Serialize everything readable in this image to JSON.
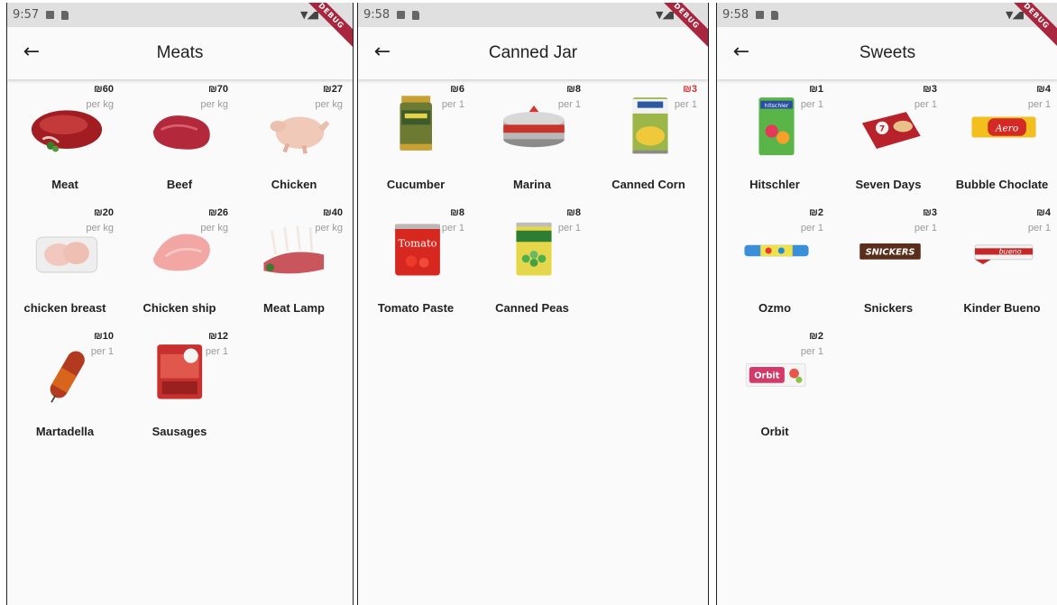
{
  "screens": [
    {
      "time": "9:57",
      "title": "Meats",
      "debug": "DEBUG",
      "items": [
        {
          "name": "Meat",
          "price": "₪60",
          "unit": "per kg",
          "icon": "meat-icon"
        },
        {
          "name": "Beef",
          "price": "₪70",
          "unit": "per kg",
          "icon": "beef-icon"
        },
        {
          "name": "Chicken",
          "price": "₪27",
          "unit": "per kg",
          "icon": "chicken-icon"
        },
        {
          "name": "chicken breast",
          "price": "₪20",
          "unit": "per kg",
          "icon": "chicken-breast-icon"
        },
        {
          "name": "Chicken ship",
          "price": "₪26",
          "unit": "per kg",
          "icon": "chicken-ship-icon"
        },
        {
          "name": "Meat Lamp",
          "price": "₪40",
          "unit": "per kg",
          "icon": "lamb-rack-icon"
        },
        {
          "name": "Martadella",
          "price": "₪10",
          "unit": "per 1",
          "icon": "mortadella-icon"
        },
        {
          "name": "Sausages",
          "price": "₪12",
          "unit": "per 1",
          "icon": "sausages-icon"
        }
      ]
    },
    {
      "time": "9:58",
      "title": "Canned Jar",
      "debug": "DEBUG",
      "items": [
        {
          "name": "Cucumber",
          "price": "₪6",
          "unit": "per 1",
          "icon": "cucumber-jar-icon"
        },
        {
          "name": "Marina",
          "price": "₪8",
          "unit": "per 1",
          "icon": "tuna-can-icon"
        },
        {
          "name": "Canned Corn",
          "price": "₪3",
          "unit": "per 1",
          "icon": "corn-can-icon",
          "price_color": "#d32f2f"
        },
        {
          "name": "Tomato Paste",
          "price": "₪8",
          "unit": "per 1",
          "icon": "tomato-paste-icon"
        },
        {
          "name": "Canned Peas",
          "price": "₪8",
          "unit": "per 1",
          "icon": "peas-can-icon"
        }
      ]
    },
    {
      "time": "9:58",
      "title": "Sweets",
      "debug": "DEBUG",
      "items": [
        {
          "name": "Hitschler",
          "price": "₪1",
          "unit": "per 1",
          "icon": "hitschler-icon"
        },
        {
          "name": "Seven Days",
          "price": "₪3",
          "unit": "per 1",
          "icon": "seven-days-icon"
        },
        {
          "name": "Bubble Choclate",
          "price": "₪4",
          "unit": "per 1",
          "icon": "aero-bar-icon"
        },
        {
          "name": "Ozmo",
          "price": "₪2",
          "unit": "per 1",
          "icon": "ozmo-icon"
        },
        {
          "name": "Snickers",
          "price": "₪3",
          "unit": "per 1",
          "icon": "snickers-icon"
        },
        {
          "name": "Kinder Bueno",
          "price": "₪4",
          "unit": "per 1",
          "icon": "kinder-bueno-icon"
        },
        {
          "name": "Orbit",
          "price": "₪2",
          "unit": "per 1",
          "icon": "orbit-gum-icon"
        }
      ]
    }
  ]
}
